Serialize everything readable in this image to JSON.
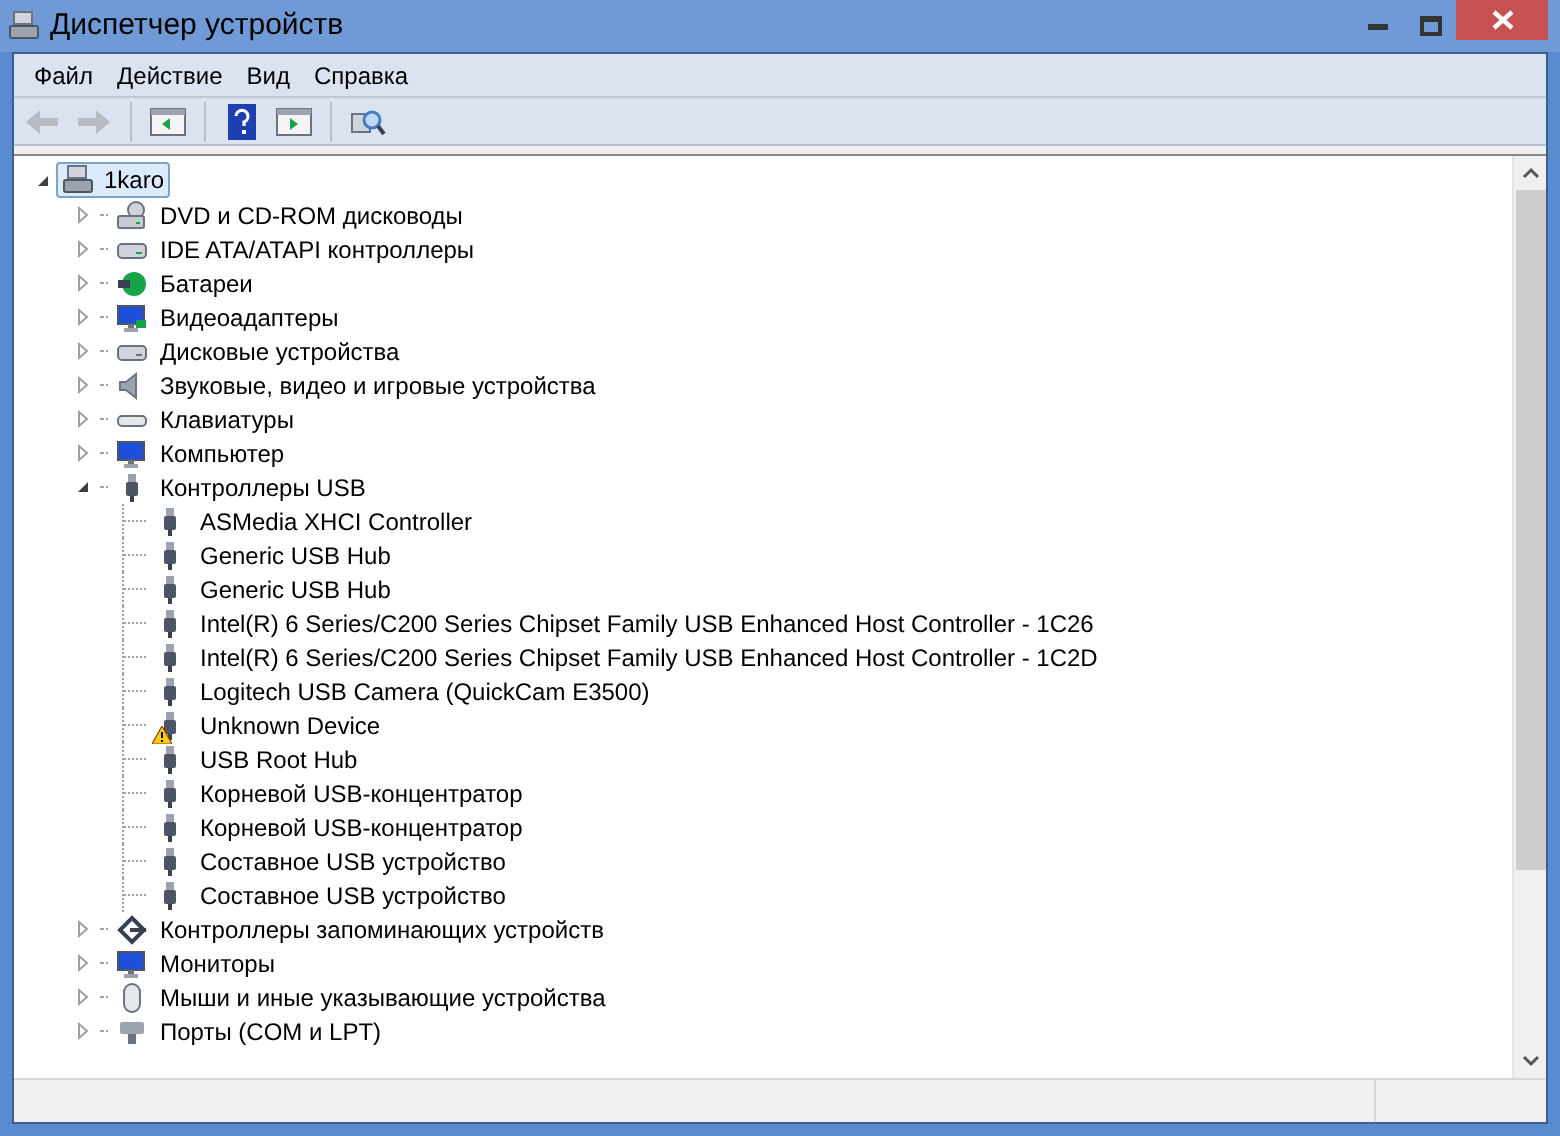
{
  "window": {
    "title": "Диспетчер устройств"
  },
  "menu": [
    "Файл",
    "Действие",
    "Вид",
    "Справка"
  ],
  "toolbar": [
    {
      "kind": "back",
      "disabled": true
    },
    {
      "kind": "forward",
      "disabled": true
    },
    {
      "kind": "sep"
    },
    {
      "kind": "tree",
      "disabled": false
    },
    {
      "kind": "sep"
    },
    {
      "kind": "help",
      "disabled": false
    },
    {
      "kind": "pane",
      "disabled": false
    },
    {
      "kind": "sep"
    },
    {
      "kind": "scan",
      "disabled": false
    }
  ],
  "tree": {
    "label": "1karo",
    "kind": "computer-root",
    "expanded": true,
    "selected": true,
    "children": [
      {
        "label": "DVD и CD-ROM дисководы",
        "kind": "disc",
        "expanded": false
      },
      {
        "label": "IDE ATA/ATAPI контроллеры",
        "kind": "ide",
        "expanded": false
      },
      {
        "label": "Батареи",
        "kind": "battery",
        "expanded": false
      },
      {
        "label": "Видеоадаптеры",
        "kind": "display",
        "expanded": false
      },
      {
        "label": "Дисковые устройства",
        "kind": "disk",
        "expanded": false
      },
      {
        "label": "Звуковые, видео и игровые устройства",
        "kind": "sound",
        "expanded": false
      },
      {
        "label": "Клавиатуры",
        "kind": "keyboard",
        "expanded": false
      },
      {
        "label": "Компьютер",
        "kind": "computer",
        "expanded": false
      },
      {
        "label": "Контроллеры USB",
        "kind": "usb",
        "expanded": true,
        "children": [
          {
            "label": "ASMedia XHCI Controller",
            "kind": "usb",
            "warning": false
          },
          {
            "label": "Generic USB Hub",
            "kind": "usb",
            "warning": false
          },
          {
            "label": "Generic USB Hub",
            "kind": "usb",
            "warning": false
          },
          {
            "label": "Intel(R) 6 Series/C200 Series Chipset Family USB Enhanced Host Controller - 1C26",
            "kind": "usb",
            "warning": false
          },
          {
            "label": "Intel(R) 6 Series/C200 Series Chipset Family USB Enhanced Host Controller - 1C2D",
            "kind": "usb",
            "warning": false
          },
          {
            "label": "Logitech USB Camera (QuickCam E3500)",
            "kind": "usb",
            "warning": false
          },
          {
            "label": "Unknown Device",
            "kind": "usb",
            "warning": true
          },
          {
            "label": "USB Root Hub",
            "kind": "usb",
            "warning": false
          },
          {
            "label": "Корневой USB-концентратор",
            "kind": "usb",
            "warning": false
          },
          {
            "label": "Корневой USB-концентратор",
            "kind": "usb",
            "warning": false
          },
          {
            "label": "Составное USB устройство",
            "kind": "usb",
            "warning": false
          },
          {
            "label": "Составное USB устройство",
            "kind": "usb",
            "warning": false
          }
        ]
      },
      {
        "label": "Контроллеры запоминающих устройств",
        "kind": "storage",
        "expanded": false
      },
      {
        "label": "Мониторы",
        "kind": "monitor",
        "expanded": false
      },
      {
        "label": "Мыши и иные указывающие устройства",
        "kind": "mouse",
        "expanded": false
      },
      {
        "label": "Порты (COM и LPT)",
        "kind": "port",
        "expanded": false
      }
    ]
  }
}
